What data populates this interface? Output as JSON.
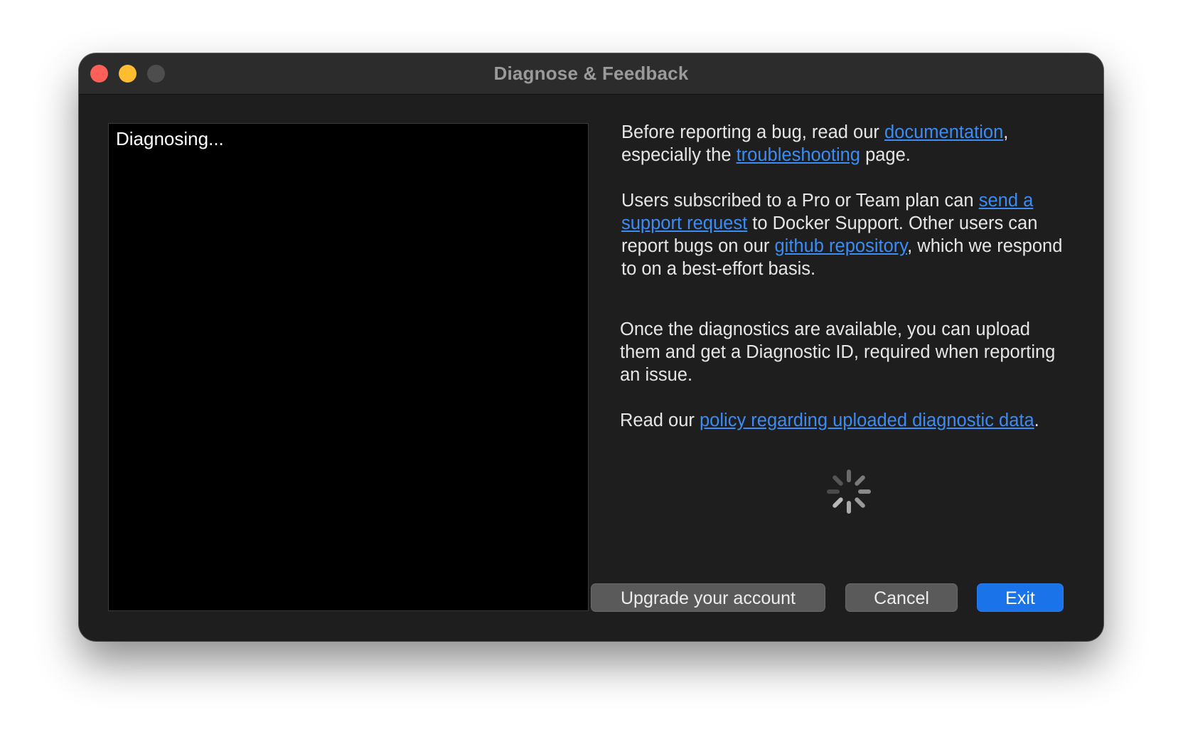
{
  "window": {
    "title": "Diagnose & Feedback"
  },
  "console": {
    "text": "Diagnosing..."
  },
  "info": {
    "p1": {
      "before_link1": "Before reporting a bug, read our ",
      "link1": "documentation",
      "after_link1": ", especially the ",
      "link2": "troubleshooting",
      "after_link2": " page."
    },
    "p2": {
      "before_link1": "Users subscribed to a Pro or Team plan can ",
      "link1": "send a support request",
      "after_link1": " to Docker Support. Other users can report bugs on our ",
      "link2": "github repository",
      "after_link2": ", which we respond to on a best-effort basis."
    },
    "p3": {
      "text": "Once the diagnostics are available, you can upload them and get a Diagnostic ID, required when reporting an issue."
    },
    "p4": {
      "before_link": "Read our ",
      "link": "policy regarding uploaded diagnostic data",
      "after_link": "."
    }
  },
  "buttons": {
    "upgrade": "Upgrade your account",
    "cancel": "Cancel",
    "exit": "Exit"
  },
  "colors": {
    "window_bg": "#1e1e1e",
    "link": "#3b8cf5",
    "primary_button": "#1a73e8",
    "close": "#fe5f57",
    "minimize": "#febc2e",
    "maximize_disabled": "#4d4d4d"
  },
  "icons": {
    "spinner": "loading-spinner-icon"
  }
}
